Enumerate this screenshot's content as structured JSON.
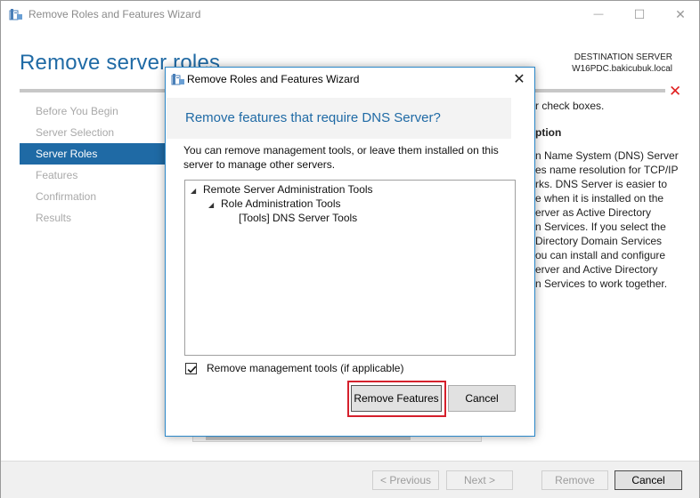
{
  "window": {
    "title": "Remove Roles and Features Wizard",
    "minimize_glyph": "—",
    "maximize_glyph": "☐",
    "close_glyph": "✕"
  },
  "page": {
    "title": "Remove server roles",
    "destination_label": "DESTINATION SERVER",
    "destination_server": "W16PDC.bakicubuk.local",
    "error_glyph": "✕",
    "error_color": "#e01f1f",
    "accent_color": "#1f6aa5"
  },
  "nav": {
    "items": [
      {
        "label": "Before You Begin",
        "active": false
      },
      {
        "label": "Server Selection",
        "active": false
      },
      {
        "label": "Server Roles",
        "active": true
      },
      {
        "label": "Features",
        "active": false
      },
      {
        "label": "Confirmation",
        "active": false
      },
      {
        "label": "Results",
        "active": false
      }
    ]
  },
  "right_panel": {
    "instruction_fragment": "r check boxes.",
    "heading_fragment": "ption",
    "description_lines": [
      "n Name System (DNS) Server",
      "es name resolution for TCP/IP",
      "rks. DNS Server is easier to",
      "e when it is installed on the",
      "erver as Active Directory",
      "n Services. If you select the",
      "Directory Domain Services",
      "ou can install and configure",
      "erver and Active Directory",
      "n Services to work together."
    ]
  },
  "footer": {
    "previous_label": "< Previous",
    "next_label": "Next >",
    "remove_label": "Remove",
    "cancel_label": "Cancel"
  },
  "dialog": {
    "title": "Remove Roles and Features Wizard",
    "close_glyph": "✕",
    "heading": "Remove features that require DNS Server?",
    "message": "You can remove management tools, or leave them installed on this server to manage other servers.",
    "tree": [
      {
        "label": "Remote Server Administration Tools",
        "level": 0,
        "expanded": true
      },
      {
        "label": "Role Administration Tools",
        "level": 1,
        "expanded": true
      },
      {
        "label": "[Tools] DNS Server Tools",
        "level": 2,
        "expanded": false
      }
    ],
    "checkbox_label": "Remove management tools (if applicable)",
    "checkbox_checked": true,
    "remove_features_label": "Remove Features",
    "cancel_label": "Cancel",
    "highlight_color": "#d5202c"
  }
}
